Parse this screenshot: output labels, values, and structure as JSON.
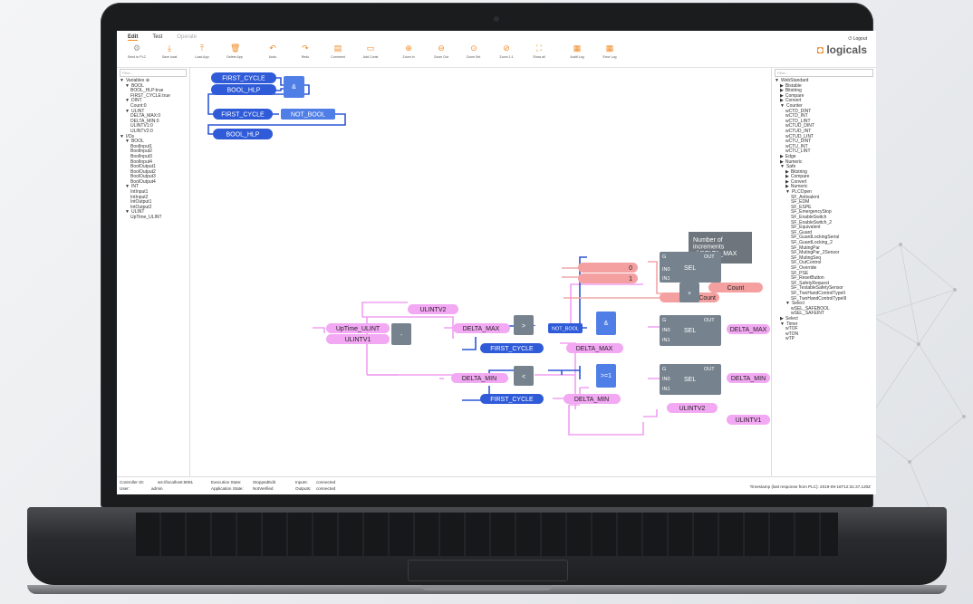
{
  "tabs": [
    "Edit",
    "Test",
    "Operate"
  ],
  "toolbar": [
    {
      "label": "Send to PLC",
      "icon": "send-to-plc-icon",
      "glyph": "⚙"
    },
    {
      "label": "Save local",
      "icon": "save-icon",
      "glyph": "⤓"
    },
    {
      "label": "Load App",
      "icon": "load-icon",
      "glyph": "⤒"
    },
    {
      "label": "Delete App",
      "icon": "trash-icon",
      "glyph": "🗑"
    },
    {
      "label": "Undo",
      "icon": "undo-icon",
      "glyph": "↶"
    },
    {
      "label": "Redo",
      "icon": "redo-icon",
      "glyph": "↷"
    },
    {
      "label": "Comment",
      "icon": "comment-icon",
      "glyph": "▤"
    },
    {
      "label": "Add Const",
      "icon": "add-const-icon",
      "glyph": "▭"
    },
    {
      "label": "Zoom In",
      "icon": "zoom-in-icon",
      "glyph": "⊕"
    },
    {
      "label": "Zoom Out",
      "icon": "zoom-out-icon",
      "glyph": "⊖"
    },
    {
      "label": "Zoom Sel.",
      "icon": "zoom-sel-icon",
      "glyph": "⊙"
    },
    {
      "label": "Zoom 1:1",
      "icon": "zoom-11-icon",
      "glyph": "⊘"
    },
    {
      "label": "Show all",
      "icon": "show-all-icon",
      "glyph": "⛶"
    },
    {
      "label": "Audit Log",
      "icon": "audit-log-icon",
      "glyph": "▦"
    },
    {
      "label": "Error Log",
      "icon": "error-log-icon",
      "glyph": "▦"
    }
  ],
  "logout": "⏻ Logout",
  "logo": {
    "text": "logicals",
    "accent": "#f08a24"
  },
  "filter_placeholder": "Filter...",
  "left_tree": [
    {
      "t": "Variables ⊕",
      "d": 0,
      "arrow": "▼"
    },
    {
      "t": "BOOL",
      "d": 1,
      "arrow": "▼"
    },
    {
      "t": "BOOL_HLP:true",
      "d": 2
    },
    {
      "t": "FIRST_CYCLE:true",
      "d": 2
    },
    {
      "t": "DINT",
      "d": 1,
      "arrow": "▼"
    },
    {
      "t": "Count:0",
      "d": 2
    },
    {
      "t": "ULINT",
      "d": 1,
      "arrow": "▼"
    },
    {
      "t": "DELTA_MAX:0",
      "d": 2
    },
    {
      "t": "DELTA_MIN:0",
      "d": 2
    },
    {
      "t": "ULINTV1:0",
      "d": 2
    },
    {
      "t": "ULINTV2:0",
      "d": 2
    },
    {
      "t": "I/Os",
      "d": 0,
      "arrow": "▼"
    },
    {
      "t": "BOOL",
      "d": 1,
      "arrow": "▼"
    },
    {
      "t": "BoolInput1",
      "d": 2
    },
    {
      "t": "BoolInput2",
      "d": 2
    },
    {
      "t": "BoolInput3",
      "d": 2
    },
    {
      "t": "BoolInput4",
      "d": 2
    },
    {
      "t": "BoolOutput1",
      "d": 2
    },
    {
      "t": "BoolOutput2",
      "d": 2
    },
    {
      "t": "BoolOutput3",
      "d": 2
    },
    {
      "t": "BoolOutput4",
      "d": 2
    },
    {
      "t": "INT",
      "d": 1,
      "arrow": "▼"
    },
    {
      "t": "IntInput1",
      "d": 2
    },
    {
      "t": "IntInput2",
      "d": 2
    },
    {
      "t": "IntOutput1",
      "d": 2
    },
    {
      "t": "IntOutput2",
      "d": 2
    },
    {
      "t": "ULINT",
      "d": 1,
      "arrow": "▼"
    },
    {
      "t": "UpTime_ULINT",
      "d": 2
    }
  ],
  "right_tree": [
    {
      "t": "WebStandard",
      "d": 0,
      "arrow": "▼"
    },
    {
      "t": "Bistable",
      "d": 1,
      "arrow": "▶"
    },
    {
      "t": "Bitstring",
      "d": 1,
      "arrow": "▶"
    },
    {
      "t": "Compare",
      "d": 1,
      "arrow": "▶"
    },
    {
      "t": "Convert",
      "d": 1,
      "arrow": "▶"
    },
    {
      "t": "Counter",
      "d": 1,
      "arrow": "▼"
    },
    {
      "t": "wCTD_DINT",
      "d": 2
    },
    {
      "t": "wCTD_INT",
      "d": 2
    },
    {
      "t": "wCTD_LINT",
      "d": 2
    },
    {
      "t": "wCTUD_DINT",
      "d": 2
    },
    {
      "t": "wCTUD_INT",
      "d": 2
    },
    {
      "t": "wCTUD_LINT",
      "d": 2
    },
    {
      "t": "wCTU_DINT",
      "d": 2
    },
    {
      "t": "wCTU_INT",
      "d": 2
    },
    {
      "t": "wCTU_LINT",
      "d": 2
    },
    {
      "t": "Edge",
      "d": 1,
      "arrow": "▶"
    },
    {
      "t": "Numeric",
      "d": 1,
      "arrow": "▶"
    },
    {
      "t": "Safe",
      "d": 1,
      "arrow": "▼"
    },
    {
      "t": "Bitstring",
      "d": 2,
      "arrow": "▶"
    },
    {
      "t": "Compare",
      "d": 2,
      "arrow": "▶"
    },
    {
      "t": "Convert",
      "d": 2,
      "arrow": "▶"
    },
    {
      "t": "Numeric",
      "d": 2,
      "arrow": "▶"
    },
    {
      "t": "PLCOpen",
      "d": 2,
      "arrow": "▼"
    },
    {
      "t": "SF_Antivalent",
      "d": 3
    },
    {
      "t": "SF_EDM",
      "d": 3
    },
    {
      "t": "SF_ESPE",
      "d": 3
    },
    {
      "t": "SF_EmergencyStop",
      "d": 3
    },
    {
      "t": "SF_EnableSwitch",
      "d": 3
    },
    {
      "t": "SF_EnableSwitch_2",
      "d": 3
    },
    {
      "t": "SF_Equivalent",
      "d": 3
    },
    {
      "t": "SF_Guard",
      "d": 3
    },
    {
      "t": "SF_GuardLockingSerial",
      "d": 3
    },
    {
      "t": "SF_GuardLocking_2",
      "d": 3
    },
    {
      "t": "SF_MutingPar",
      "d": 3
    },
    {
      "t": "SF_MutingPar_2Sensor",
      "d": 3
    },
    {
      "t": "SF_MutingSeq",
      "d": 3
    },
    {
      "t": "SF_OutControl",
      "d": 3
    },
    {
      "t": "SF_Override",
      "d": 3
    },
    {
      "t": "SF_PSE",
      "d": 3
    },
    {
      "t": "SF_ResetButton",
      "d": 3
    },
    {
      "t": "SF_SafetyRequest",
      "d": 3
    },
    {
      "t": "SF_TestableSafetySensor",
      "d": 3
    },
    {
      "t": "SF_TwoHandControlTypeII",
      "d": 3
    },
    {
      "t": "SF_TwoHandControlTypeIII",
      "d": 3
    },
    {
      "t": "Select",
      "d": 2,
      "arrow": "▼"
    },
    {
      "t": "wSEL_SAFEBOOL",
      "d": 3
    },
    {
      "t": "wSEL_SAFEINT",
      "d": 3
    },
    {
      "t": "Select",
      "d": 1,
      "arrow": "▶"
    },
    {
      "t": "Timer",
      "d": 1,
      "arrow": "▼"
    },
    {
      "t": "wTOF",
      "d": 2
    },
    {
      "t": "wTON",
      "d": 2
    },
    {
      "t": "wTP",
      "d": 2
    }
  ],
  "diagram": {
    "top": {
      "first_cycle": "FIRST_CYCLE",
      "bool_hlp": "BOOL_HLP",
      "and": "&",
      "not": "NOT_BOOL"
    },
    "comment": "Number of increments of DELTA_MAX",
    "uptime": "UpTime_ULINT",
    "ulintv1": "ULINTV1",
    "ulintv2": "ULINTV2",
    "minus": "-",
    "gt": ">",
    "lt": "<",
    "ge": ">=1",
    "not_bool": "NOT_BOOL",
    "and": "&",
    "delta_max": "DELTA_MAX",
    "delta_min": "DELTA_MIN",
    "first_cycle": "FIRST_CYCLE",
    "const0": "0",
    "const1": "1",
    "count": "Count",
    "plus": "+",
    "sel": {
      "title": "SEL",
      "g": "G",
      "in0": "IN0",
      "in1": "IN1",
      "out": "OUT"
    }
  },
  "status": {
    "controller_label": "Controller ID:",
    "controller": "ws://localhost:8081",
    "user_label": "User:",
    "user": "admin",
    "exec_label": "Execution State:",
    "exec": "StoppedEdit",
    "app_label": "Application State:",
    "app": "NotVerified",
    "inputs_label": "Inputs:",
    "inputs": "connected",
    "outputs_label": "Outputs:",
    "outputs": "connected",
    "timestamp": "Timestamp (last response from PLC): 2019-09-16T12:31:37.120Z"
  },
  "colors": {
    "accent": "#f08a24",
    "bool": "#2f5bd8",
    "ulint": "#f2a8f2",
    "dint": "#f4a0a0",
    "block": "#76838f",
    "blue_wire": "#2d57d6",
    "pink_wire": "#f0a0f0",
    "red_wire": "#f1a7a7"
  }
}
